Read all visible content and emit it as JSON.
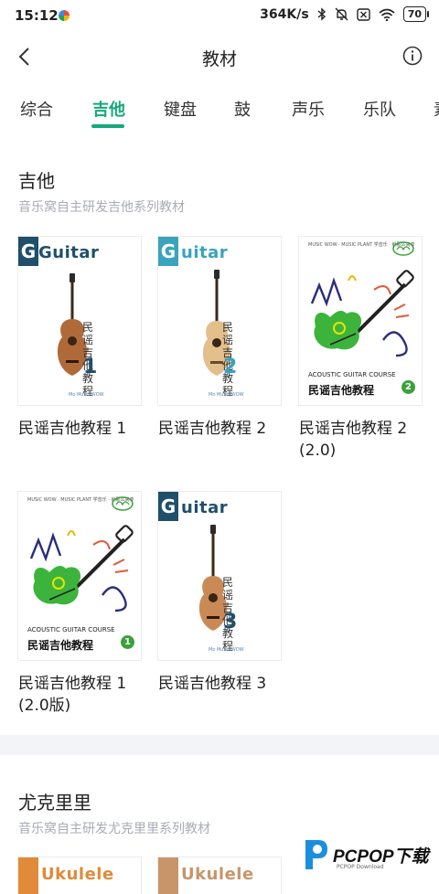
{
  "status_bar": {
    "time": "15:12",
    "speed": "364K/s",
    "battery": "70"
  },
  "header": {
    "title": "教材"
  },
  "tabs": [
    "综合",
    "吉他",
    "键盘",
    "鼓",
    "声乐",
    "乐队",
    "素"
  ],
  "sections": [
    {
      "title": "吉他",
      "subtitle": "音乐窝自主研发吉他系列教材",
      "books": [
        {
          "title": "民谣吉他教程 1",
          "cover_word": "Guitar",
          "badge": "G",
          "vertical_title": "民谣吉他教程",
          "number": "1",
          "publisher": "Mo Music WOW"
        },
        {
          "title": "民谣吉他教程 2",
          "cover_word": "uitar",
          "badge": "G",
          "vertical_title": "民谣吉他教程",
          "number": "2",
          "publisher": "Mo Music WOW"
        },
        {
          "title": "民谣吉他教程 2 (2.0)",
          "top_text": "MUSIC WOW · MUSIC PLANT 学音乐 · 就那么简单",
          "course_text": "ACOUSTIC GUITAR COURSE",
          "cn_title": "民谣吉他教程",
          "number": "2",
          "logo": "音乐窝"
        },
        {
          "title": "民谣吉他教程 1 (2.0版)",
          "top_text": "MUSIC WOW · MUSIC PLANT 学音乐 · 就那么简单",
          "course_text": "ACOUSTIC GUITAR COURSE",
          "cn_title": "民谣吉他教程",
          "number": "1",
          "logo": "音乐窝"
        },
        {
          "title": "民谣吉他教程 3",
          "cover_word": "uitar",
          "badge": "G",
          "vertical_title": "民谣吉他教程",
          "number": "3",
          "publisher": "Mo Music WOW"
        }
      ]
    },
    {
      "title": "尤克里里",
      "subtitle": "音乐窝自主研发尤克里里系列教材",
      "books": [
        {
          "cover_word": "Ukulele"
        },
        {
          "cover_word": "Ukulele"
        }
      ]
    }
  ],
  "watermark": {
    "name": "PCPOP下载",
    "sub": "PCPOP Download"
  },
  "colors": {
    "accent": "#14a87a",
    "guitar_dark": "#1f4f6b",
    "guitar_teal": "#3aa3bd",
    "green_guitar": "#3cb43c",
    "ukulele": "#e08a3a"
  }
}
